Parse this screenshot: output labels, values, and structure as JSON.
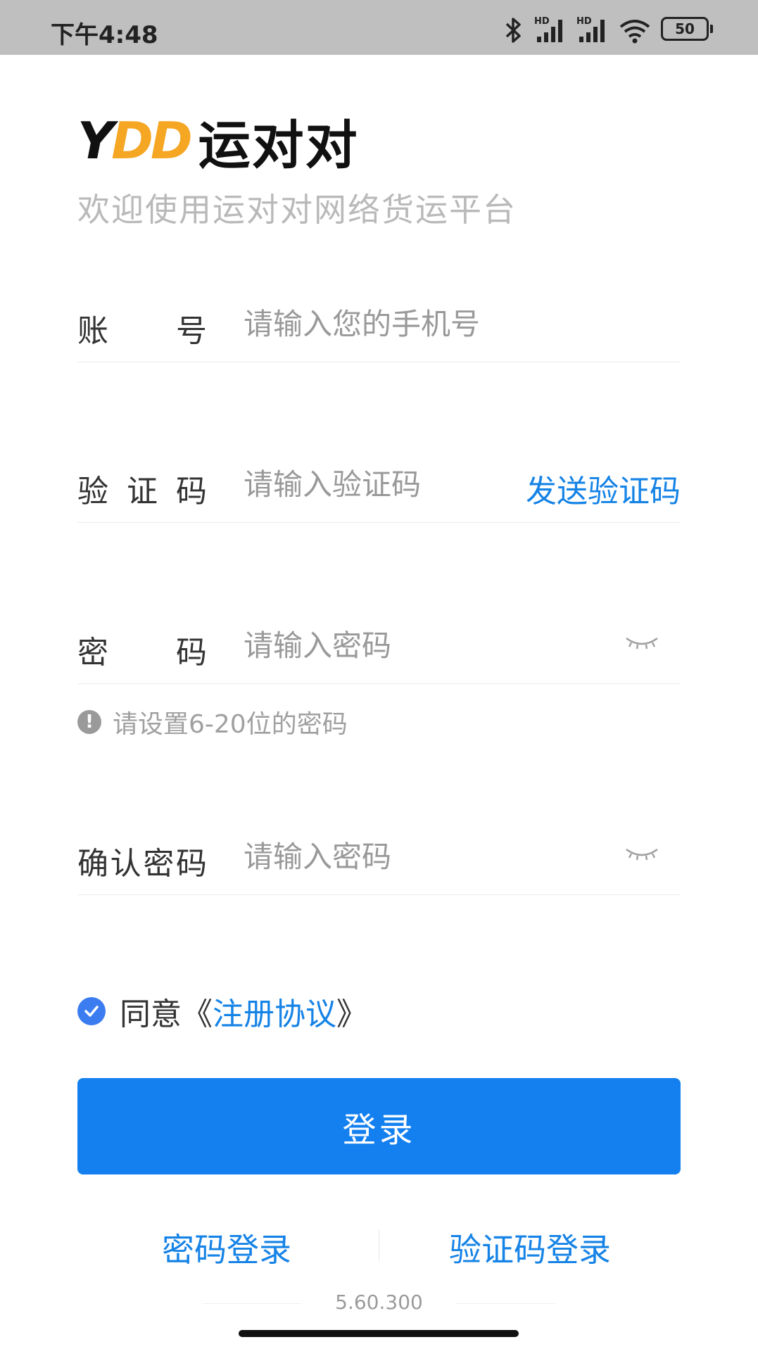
{
  "status_bar": {
    "time": "下午4:48",
    "battery": "50",
    "icons": [
      "bluetooth-icon",
      "signal-hd-icon",
      "signal-hd-icon",
      "wifi-icon",
      "battery-icon"
    ],
    "hd_label": "HD"
  },
  "logo": {
    "letters": [
      "Y",
      "D",
      "D"
    ],
    "text_cn": "运对对",
    "colors": {
      "y": "#111111",
      "d": "#f5a623",
      "cn": "#111111"
    }
  },
  "welcome": "欢迎使用运对对网络货运平台",
  "fields": {
    "account": {
      "label_chars": [
        "账",
        "号"
      ],
      "placeholder": "请输入您的手机号",
      "value": ""
    },
    "code": {
      "label_chars": [
        "验",
        "证",
        "码"
      ],
      "placeholder": "请输入验证码",
      "value": "",
      "send_label": "发送验证码"
    },
    "password": {
      "label_chars": [
        "密",
        "码"
      ],
      "placeholder": "请输入密码",
      "value": "",
      "toggle_icon": "eye-closed-icon"
    },
    "confirm": {
      "label_chars": [
        "确",
        "认",
        "密",
        "码"
      ],
      "placeholder": "请输入密码",
      "value": "",
      "toggle_icon": "eye-closed-icon"
    }
  },
  "password_hint": {
    "icon": "!",
    "text": "请设置6-20位的密码"
  },
  "agreement": {
    "checked": true,
    "prefix": "同意《",
    "link": "注册协议",
    "suffix": "》"
  },
  "login_button": "登录",
  "alt_login": {
    "password": "密码登录",
    "code": "验证码登录"
  },
  "version": "5.60.300",
  "colors": {
    "accent": "#1480f0",
    "link": "#1683e6",
    "check": "#3b7cf0",
    "status_bar": "#bfbfbf"
  }
}
